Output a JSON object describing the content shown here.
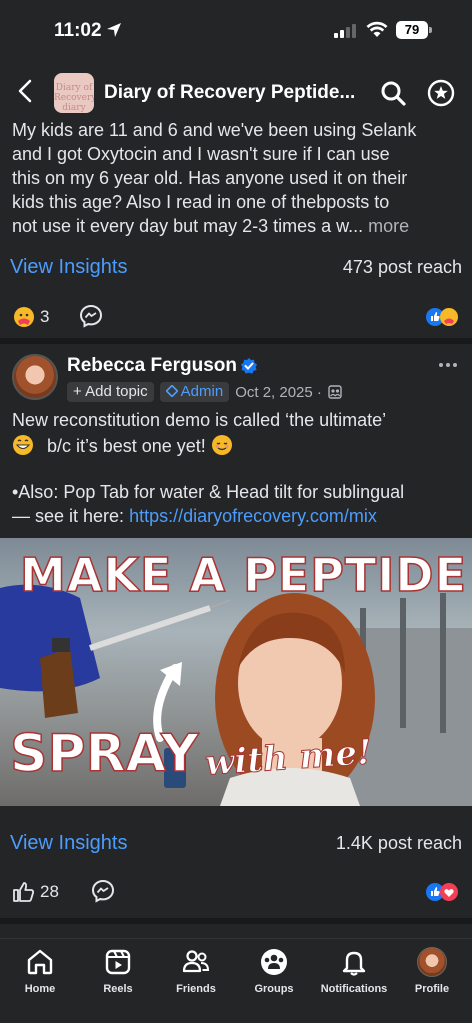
{
  "status": {
    "time": "11:02",
    "battery": "79"
  },
  "header": {
    "title": "Diary of Recovery Peptide...",
    "group_avatar_text": "Diary of Recovery diary"
  },
  "post1": {
    "text_lines": [
      "My kids are 11 and 6 and we've been using Selank",
      "and I got Oxytocin and I wasn't sure if I can use",
      "this on my 6 year old.  Has anyone used it on their",
      "kids this age?  Also I read in one of thebposts to",
      "not use it every day but may 2-3 times a w... "
    ],
    "more_label": "more",
    "view_insights": "View Insights",
    "post_reach": "473 post reach",
    "reaction_count": "3"
  },
  "post2": {
    "author": "Rebecca Ferguson",
    "add_topic": "+ Add topic",
    "admin_badge": "Admin",
    "date": "Oct 2, 2025 ·",
    "text_line1": "New reconstitution demo is called ‘the ultimate’",
    "text_line2": "b/c it’s best one yet!",
    "text_line3": "•Also: Pop Tab for water & Head tilt for sublingual",
    "text_line4_prefix": "— see it here:",
    "link": "https://diaryofrecovery.com/mix",
    "image_headline": "MAKE A PEPTIDE",
    "image_spray": "SPRAY",
    "image_with": "with me!",
    "view_insights": "View Insights",
    "post_reach": "1.4K post reach",
    "like_count": "28"
  },
  "nav": [
    {
      "label": "Home",
      "icon": "home-icon"
    },
    {
      "label": "Reels",
      "icon": "reels-icon"
    },
    {
      "label": "Friends",
      "icon": "friends-icon"
    },
    {
      "label": "Groups",
      "icon": "groups-icon"
    },
    {
      "label": "Notifications",
      "icon": "bell-icon"
    },
    {
      "label": "Profile",
      "icon": "profile-avatar"
    }
  ],
  "colors": {
    "background": "#242526",
    "link": "#4c9dfe",
    "divider": "#18191a"
  }
}
